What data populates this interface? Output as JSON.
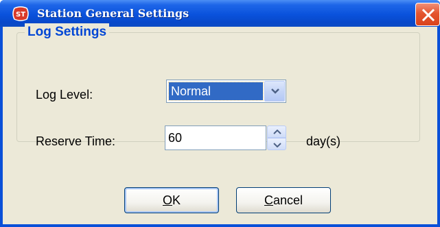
{
  "window": {
    "title": "Station General Settings",
    "icon": "st-app-icon",
    "close_icon": "close-icon"
  },
  "group": {
    "title": "Log Settings"
  },
  "log_level": {
    "label": "Log Level:",
    "selected": "Normal"
  },
  "reserve_time": {
    "label": "Reserve Time:",
    "value": "60",
    "unit": "day(s)"
  },
  "buttons": {
    "ok_mnemonic": "O",
    "ok_rest": "K",
    "cancel_mnemonic": "C",
    "cancel_rest": "ancel"
  },
  "colors": {
    "titlebar": "#0A50D8",
    "client_bg": "#ECE9D8",
    "group_title": "#0046D5",
    "selection": "#316AC5",
    "close_button": "#E4552F"
  }
}
